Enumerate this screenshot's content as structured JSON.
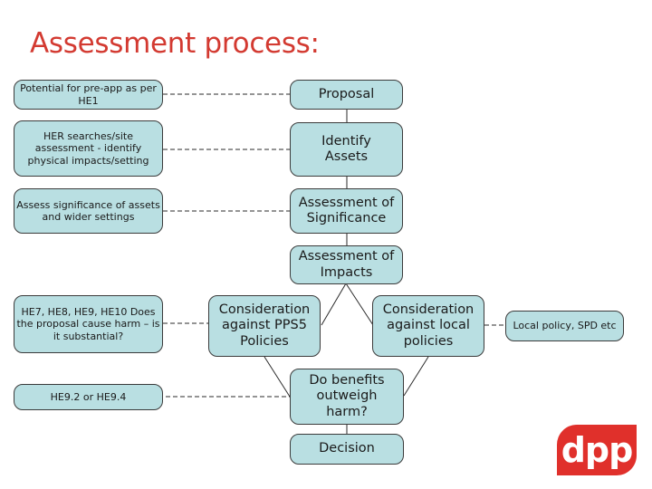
{
  "title": "Assessment process:",
  "left_notes": [
    "Potential for pre-app as per HE1",
    "HER searches/site assessment - identify physical impacts/setting",
    "Assess significance of assets and wider settings",
    "HE7, HE8, HE9, HE10 Does the proposal cause harm – is it substantial?",
    "HE9.2 or HE9.4"
  ],
  "steps": {
    "proposal": "Proposal",
    "identify": "Identify Assets",
    "significance": "Assessment of Significance",
    "impacts": "Assessment of Impacts",
    "pps5": "Consideration against PPS5 Policies",
    "local": "Consideration against local policies",
    "benefits": "Do benefits outweigh harm?",
    "decision": "Decision"
  },
  "right_note": "Local policy, SPD etc",
  "logo": "dpp",
  "colors": {
    "title": "#d33a31",
    "box_fill": "#b9dfe2",
    "logo": "#e0302b"
  }
}
